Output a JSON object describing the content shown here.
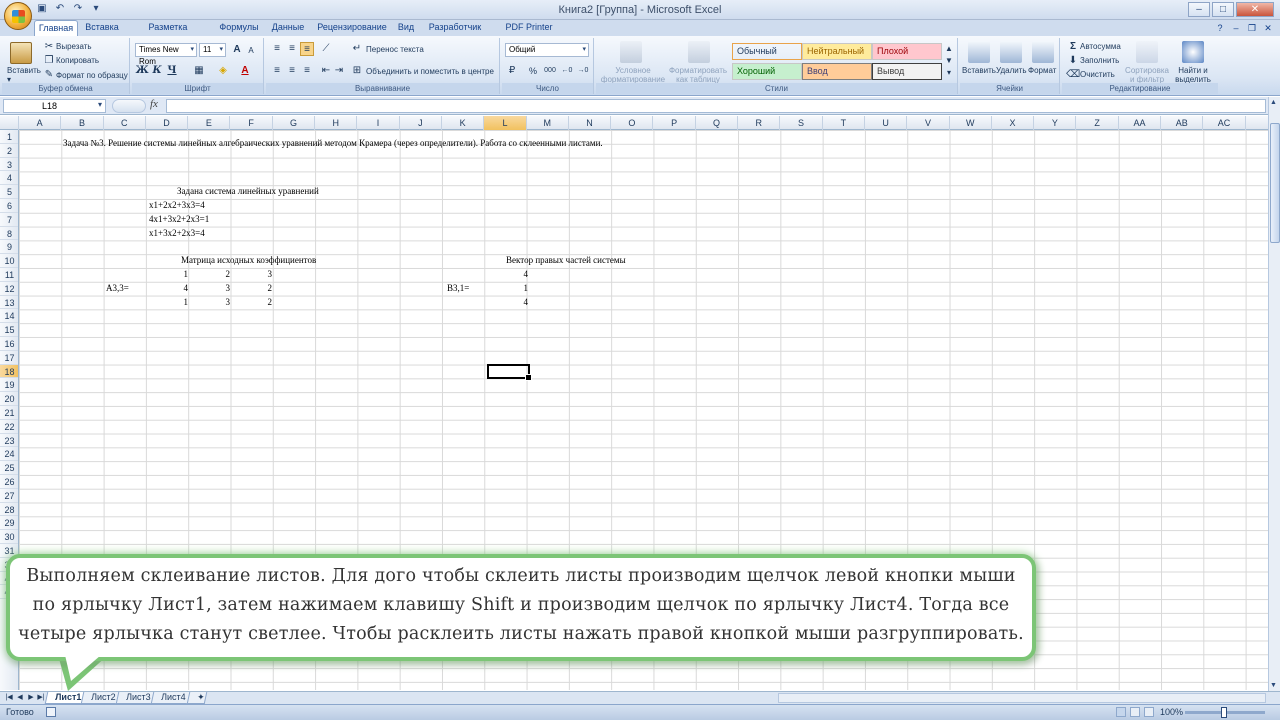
{
  "window": {
    "title": "Книга2 [Группа] - Microsoft Excel",
    "qat_icons": [
      "save-icon",
      "undo-icon",
      "redo-icon",
      "dropdown-icon"
    ]
  },
  "tabs": [
    "Главная",
    "Вставка",
    "Разметка страницы",
    "Формулы",
    "Данные",
    "Рецензирование",
    "Вид",
    "Разработчик",
    "PDF Printer (Free)"
  ],
  "ribbon": {
    "clipboard": {
      "paste": "Вставить",
      "cut": "Вырезать",
      "copy": "Копировать",
      "format_painter": "Формат по образцу",
      "label": "Буфер обмена"
    },
    "font": {
      "name": "Times New Rom",
      "size": "11",
      "bold": "Ж",
      "italic": "К",
      "underline": "Ч",
      "grow": "A",
      "shrink": "A",
      "label": "Шрифт"
    },
    "alignment": {
      "wrap": "Перенос текста",
      "merge": "Объединить и поместить в центре",
      "label": "Выравнивание"
    },
    "number": {
      "format": "Общий",
      "percent": "%",
      "thousands": "000",
      "label": "Число"
    },
    "styles": {
      "conditional": "Условное форматирование",
      "as_table": "Форматировать как таблицу",
      "cells": [
        {
          "name": "Обычный",
          "bg": "#ffffff",
          "fg": "#000000"
        },
        {
          "name": "Нейтральный",
          "bg": "#ffeb9c",
          "fg": "#9c6500"
        },
        {
          "name": "Плохой",
          "bg": "#ffc7ce",
          "fg": "#9c0006"
        },
        {
          "name": "Хороший",
          "bg": "#c6efce",
          "fg": "#006100"
        },
        {
          "name": "Ввод",
          "bg": "#ffcc99",
          "fg": "#3f3f76"
        },
        {
          "name": "Вывод",
          "bg": "#f2f2f2",
          "fg": "#3f3f3f"
        }
      ],
      "label": "Стили"
    },
    "cells_group": {
      "insert": "Вставить",
      "delete": "Удалить",
      "format": "Формат",
      "label": "Ячейки"
    },
    "editing": {
      "autosum": "Автосумма",
      "fill": "Заполнить",
      "clear": "Очистить",
      "sort": "Сортировка и фильтр",
      "find": "Найти и выделить",
      "label": "Редактирование"
    }
  },
  "formula_bar": {
    "name_box": "L18",
    "fx": "fx",
    "value": ""
  },
  "columns": [
    "A",
    "B",
    "C",
    "D",
    "E",
    "F",
    "G",
    "H",
    "I",
    "J",
    "K",
    "L",
    "M",
    "N",
    "O",
    "P",
    "Q",
    "R",
    "S",
    "T",
    "U",
    "V",
    "W",
    "X",
    "Y",
    "Z",
    "AA",
    "AB",
    "AC"
  ],
  "selected_column": "L",
  "selected_row": 18,
  "rows_visible": [
    1,
    2,
    3,
    4,
    5,
    6,
    7,
    8,
    9,
    10,
    11,
    12,
    13,
    14,
    15,
    16,
    17,
    18,
    19,
    20,
    21,
    22,
    23,
    24,
    25,
    26,
    27,
    28,
    29,
    30,
    31,
    39,
    40,
    41
  ],
  "cells": {
    "title": "Задача №3. Решение системы линейных алгебраических уравнений методом Крамера (через определители). Работа со склеенными листами.",
    "system_header": "Задана система линейных уравнений",
    "eq1": "x1+2x2+3x3=4",
    "eq2": "4x1+3x2+2x3=1",
    "eq3": "x1+3x2+2x3=4",
    "matrix_header": "Матрица исходных коэффициентов",
    "matrix_label": "A3,3=",
    "matrix": [
      [
        "1",
        "2",
        "3"
      ],
      [
        "4",
        "3",
        "2"
      ],
      [
        "1",
        "3",
        "2"
      ]
    ],
    "vector_header": "Вектор правых частей системы",
    "vector_label": "B3,1=",
    "vector": [
      "4",
      "1",
      "4"
    ]
  },
  "sheets": [
    "Лист1",
    "Лист2",
    "Лист3",
    "Лист4"
  ],
  "active_sheet": "Лист1",
  "status": {
    "text": "Готово",
    "zoom": "100%"
  },
  "callout": {
    "lines": [
      "Выполняем склеивание листов. Для дого чтобы склеить листы производим щелчок левой кнопки мыши",
      "по ярлычку Лист1, затем нажимаем клавишу Shift и производим щелчок по ярлычку Лист4. Тогда все",
      "четыре ярлычка станут светлее. Чтобы расклеить листы нажать правой кнопкой мыши разгруппировать."
    ]
  }
}
